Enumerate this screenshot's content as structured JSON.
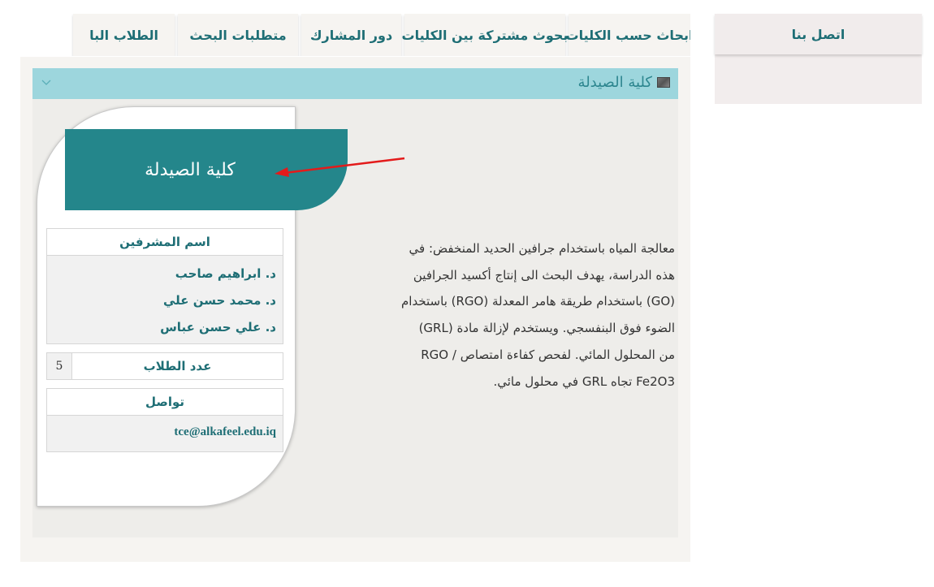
{
  "nav": {
    "tabs": [
      {
        "label": "ابحاث حسب الكليات"
      },
      {
        "label": "بحوث مشتركة بين الكليات"
      },
      {
        "label": "دور المشارك"
      },
      {
        "label": "متطلبات البحث"
      },
      {
        "label": "الطلاب البا"
      }
    ]
  },
  "contact": {
    "label": "اتصل بنا"
  },
  "panel": {
    "title": "كلية الصيدلة",
    "banner": "كلية الصيدلة"
  },
  "supervisors": {
    "heading": "اسم المشرفين",
    "names": [
      "د. ابراهيم صاحب",
      "د. محمد حسن علي",
      "د. علي حسن عباس"
    ]
  },
  "students": {
    "label": "عدد الطلاب",
    "count": "5"
  },
  "communication": {
    "heading": "تواصل",
    "email": "tce@alkafeel.edu.iq"
  },
  "description": {
    "lines": [
      "معالجة المياه باستخدام جرافين الحديد المنخفض: في",
      "هذه الدراسة، يهدف البحث الى إنتاج أكسيد الجرافين",
      "(GO) باستخدام طريقة هامر المعدلة (RGO) باستخدام",
      "الضوء فوق البنفسجي.  ويستخدم لإزالة مادة (GRL)",
      "من المحلول المائي. لفحص كفاءة امتصاص / RGO",
      "Fe2O3 تجاه GRL في محلول مائي."
    ]
  },
  "colors": {
    "accent": "#24868b",
    "header": "#9dd6dd",
    "text": "#1e6e75",
    "arrow": "#e31b1b"
  }
}
